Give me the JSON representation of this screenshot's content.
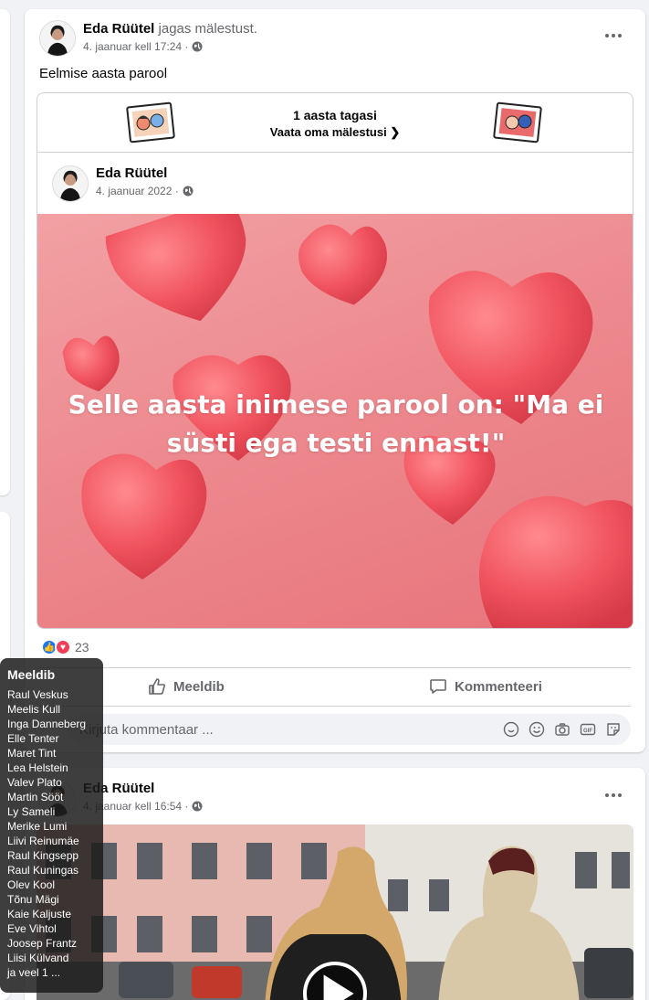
{
  "post1": {
    "author": "Eda Rüütel",
    "verb": "jagas mälestust.",
    "timestamp": "4. jaanuar kell 17:24 ·",
    "text": "Eelmise aasta parool",
    "memory": {
      "title": "1 aasta tagasi",
      "link": "Vaata oma mälestusi",
      "author": "Eda Rüütel",
      "date": "4. jaanuar 2022 ·",
      "image_text": "Selle aasta inimese parool on: \"Ma ei süsti ega testi ennast!\""
    },
    "reaction_count": "23",
    "like_label": "Meeldib",
    "comment_label": "Kommenteeri",
    "comment_placeholder": "Kirjuta kommentaar ..."
  },
  "post2": {
    "author": "Eda Rüütel",
    "timestamp": "4. jaanuar kell 16:54 ·"
  },
  "tooltip": {
    "title": "Meeldib",
    "names": [
      "Raul Veskus",
      "Meelis Kull",
      "Inga Danneberg",
      "Elle Tenter",
      "Maret Tint",
      "Lea Helstein",
      "Valev Plato",
      "Martin Sööt",
      "Ly Sameli",
      "Merike Lumi",
      "Liivi Reinumäe",
      "Raul Kingsepp",
      "Raul Kuningas",
      "Olev Kool",
      "Tõnu Mägi",
      "Kaie Kaljuste",
      "Eve Vihtol",
      "Joosep Frantz",
      "Liisi Külvand",
      "ja veel 1 ..."
    ]
  },
  "colors": {
    "like_blue": "#1877f2",
    "love_red": "#f33e58",
    "heart_bg": "#ec8a8f"
  },
  "icons": [
    "globe-icon",
    "more-icon",
    "chevron-right-icon",
    "like-icon",
    "comment-icon",
    "emoji-icon",
    "camera-icon",
    "gif-icon",
    "sticker-icon",
    "play-icon"
  ]
}
